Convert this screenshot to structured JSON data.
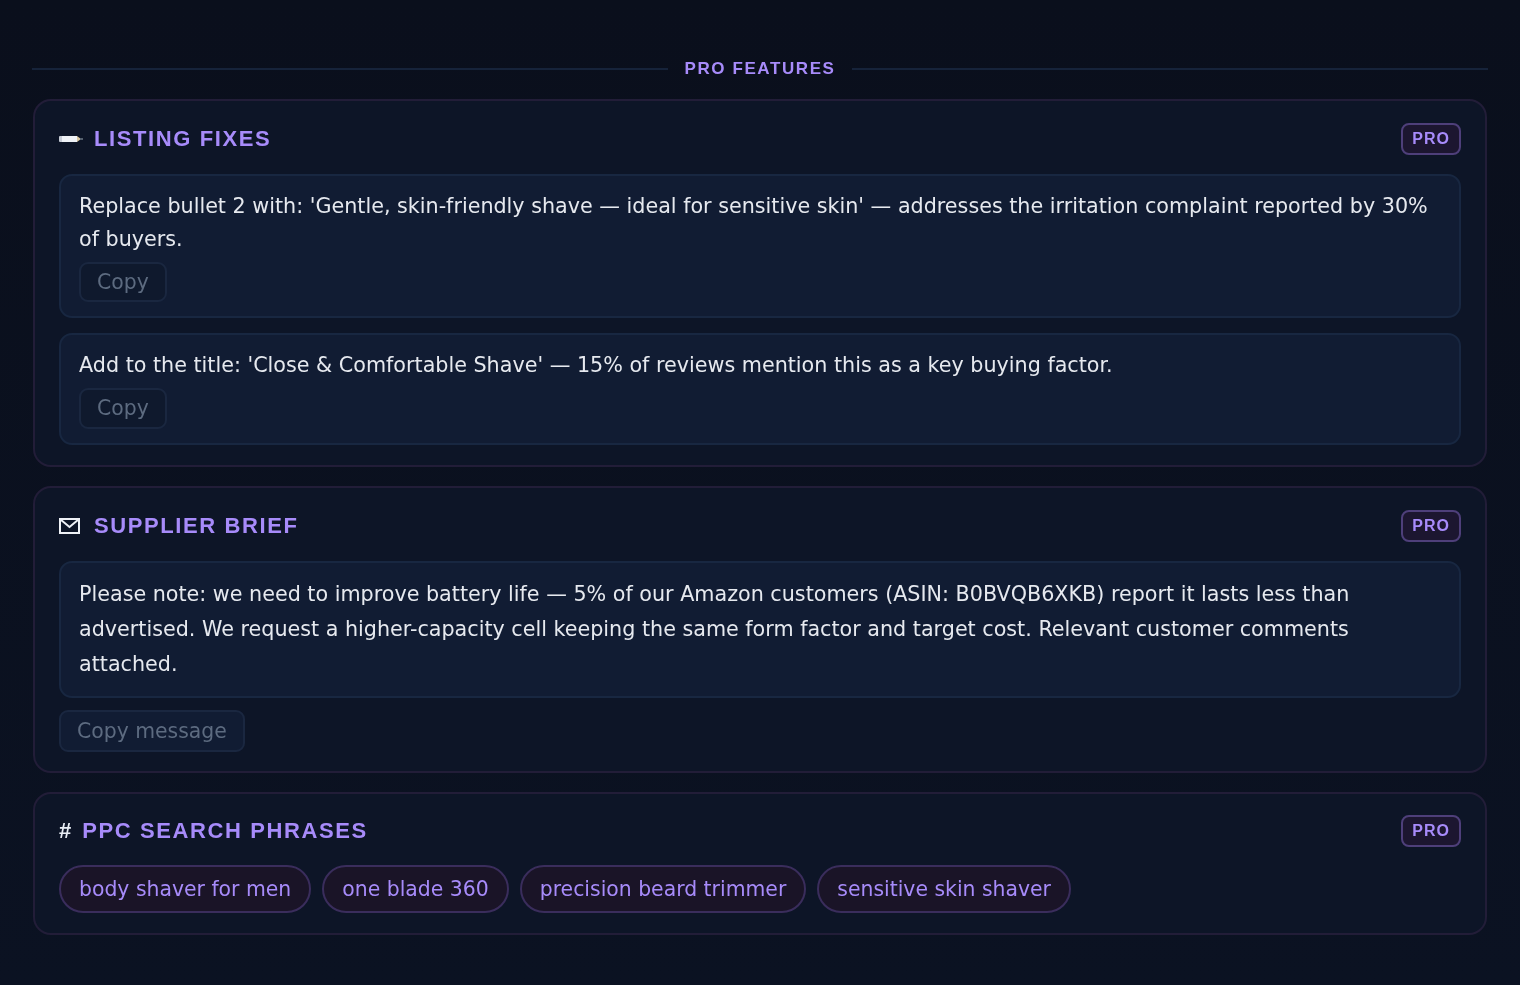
{
  "header": {
    "title": "PRO FEATURES"
  },
  "sections": [
    {
      "kind": "fixes",
      "title": "LISTING FIXES",
      "badge": "PRO",
      "items": [
        {
          "text": "Replace bullet 2 with: 'Gentle, skin-friendly shave — ideal for sensitive skin' — addresses the irritation complaint reported by 30% of buyers.",
          "button": "Copy"
        },
        {
          "text": "Add to the title: 'Close & Comfortable Shave' — 15% of reviews mention this as a key buying factor.",
          "button": "Copy"
        }
      ]
    },
    {
      "kind": "brief",
      "title": "SUPPLIER BRIEF",
      "badge": "PRO",
      "message": "Please note: we need to improve battery life — 5% of our Amazon customers (ASIN: B0BVQB6XKB) report it lasts less than advertised. We request a higher-capacity cell keeping the same form factor and target cost. Relevant customer comments attached.",
      "button": "Copy message"
    },
    {
      "kind": "phrases",
      "symbol": "#",
      "title": "PPC SEARCH PHRASES",
      "badge": "PRO",
      "phrases": [
        "body shaver for men",
        "one blade 360",
        "precision beard trimmer",
        "sensitive skin shaver"
      ]
    }
  ]
}
